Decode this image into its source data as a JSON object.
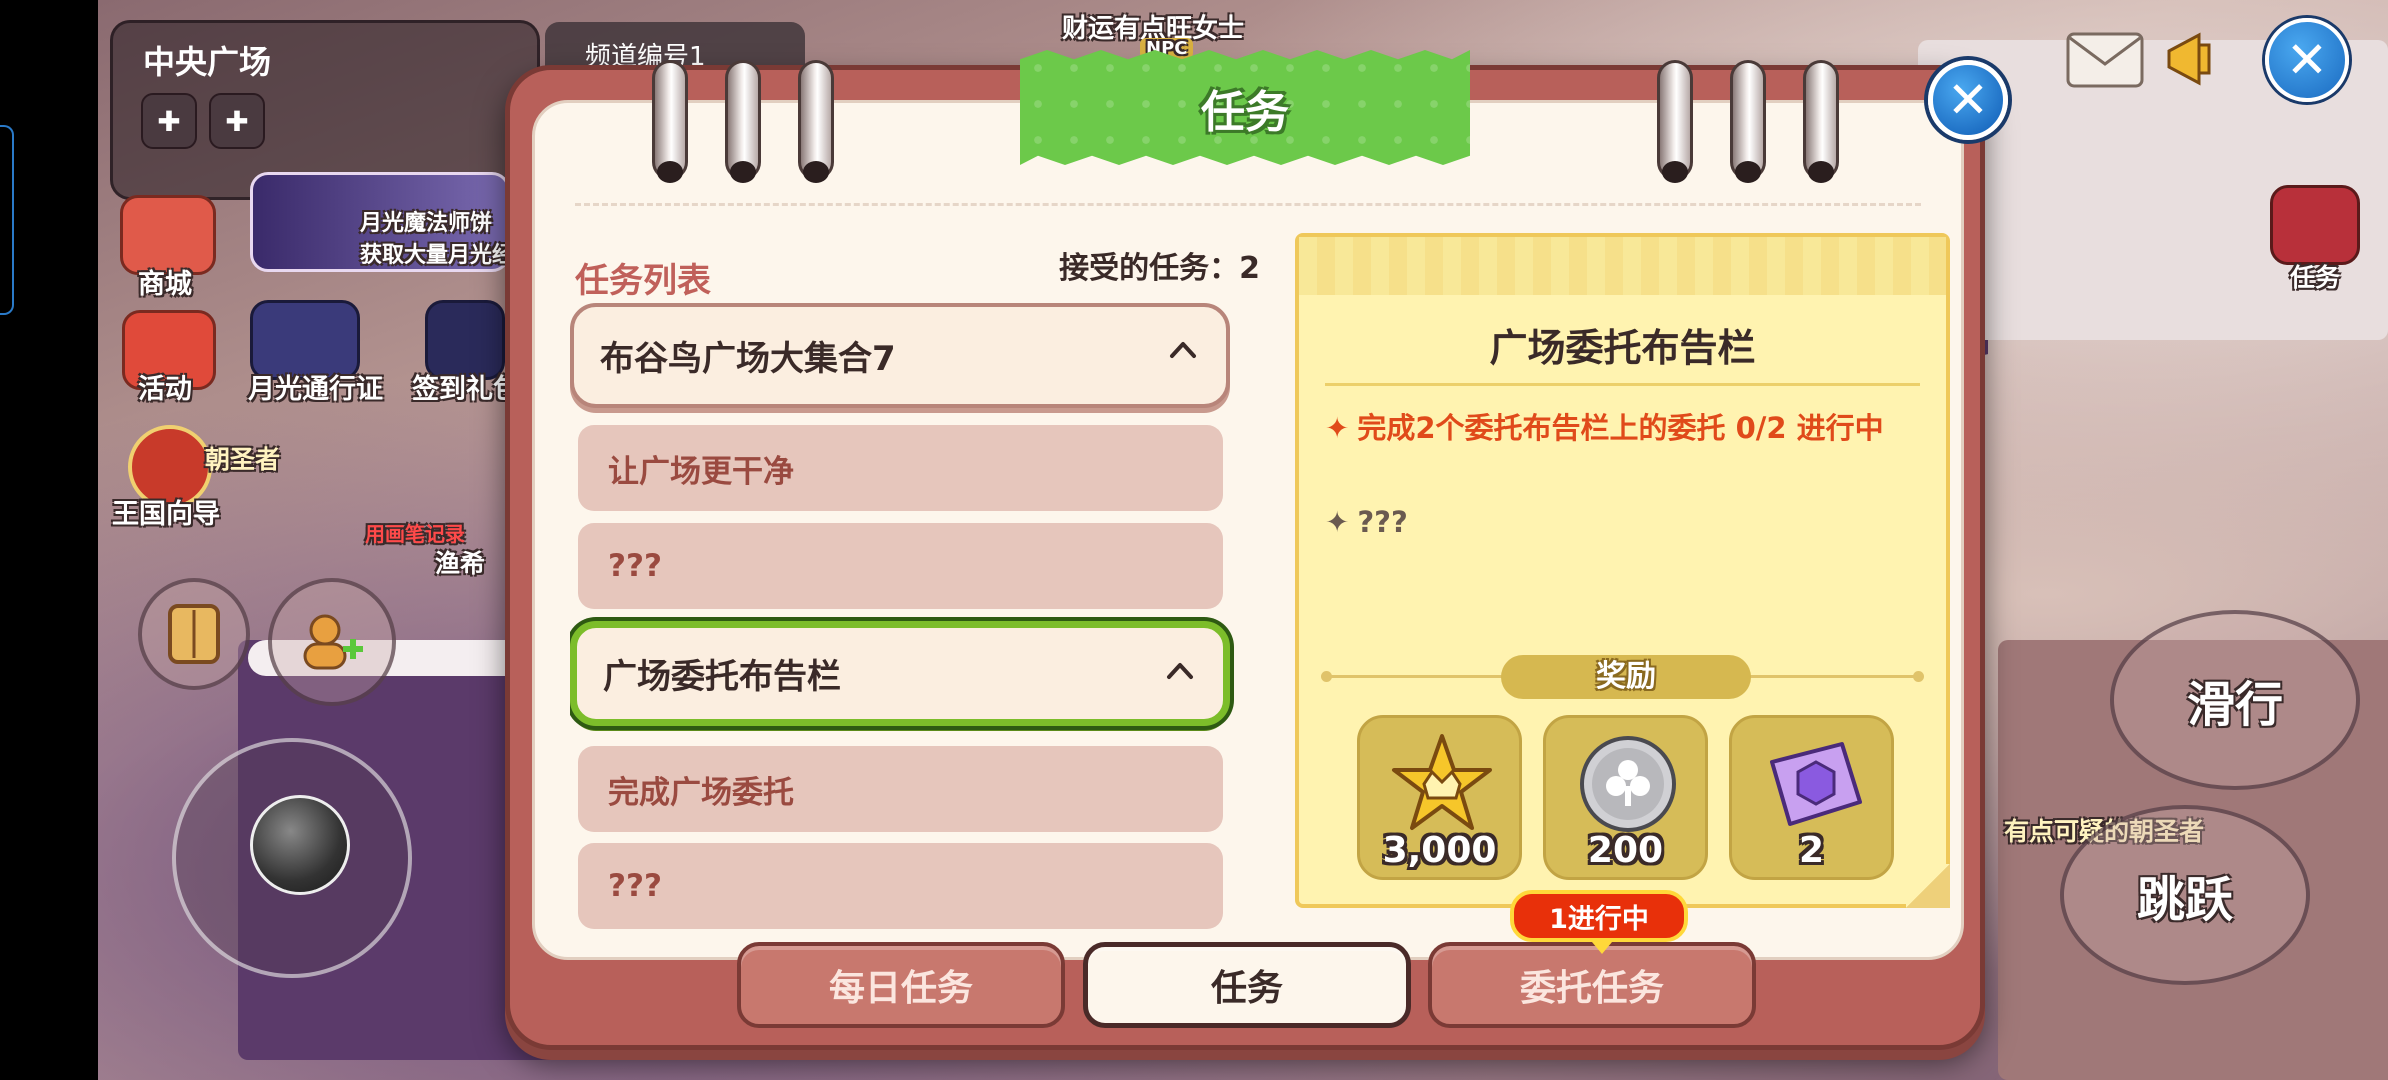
{
  "hud": {
    "location_title": "中央广场",
    "channel_label": "频道编号1",
    "npc_top_name": "财运有点旺女士",
    "npc_tag": "NPC",
    "left_menu": [
      {
        "label": "商城",
        "icon": "shop-icon"
      },
      {
        "label": "活动",
        "icon": "gift-icon"
      },
      {
        "label": "月光通行证",
        "icon": "moon-pass-icon"
      },
      {
        "label": "签到礼包",
        "icon": "checkin-icon"
      },
      {
        "label": "王国向导",
        "icon": "compass-icon"
      }
    ],
    "event_banner_line1": "月光魔法师饼",
    "event_banner_line2": "获取大量月光经",
    "pilgrim_label": "朝圣者",
    "fisherman_label": "渔希",
    "guestbook_label": "用画笔记录",
    "right_npc_name": "有点可疑的朝圣者",
    "quest_hud_label": "任务",
    "action_slide": "滑行",
    "action_jump": "跳跃"
  },
  "dialog": {
    "title": "任务",
    "list_title": "任务列表",
    "accepted_label": "接受的任务：",
    "accepted_count": "2",
    "quest_groups": [
      {
        "title": "布谷鸟广场大集合7",
        "expanded": true,
        "selected": false,
        "subtasks": [
          "让广场更干净",
          "???"
        ]
      },
      {
        "title": "广场委托布告栏",
        "expanded": true,
        "selected": true,
        "subtasks": [
          "完成广场委托",
          "???"
        ]
      }
    ],
    "detail": {
      "title": "广场委托布告栏",
      "objectives": [
        {
          "text": "完成2个委托布告栏上的委托 0/2 进行中",
          "status": "active"
        },
        {
          "text": "???",
          "status": "hidden"
        }
      ],
      "reward_label": "奖励",
      "rewards": [
        {
          "item": "crown-star-icon",
          "qty": "3,000"
        },
        {
          "item": "silver-clover-coin-icon",
          "qty": "200"
        },
        {
          "item": "purple-gem-book-icon",
          "qty": "2"
        }
      ]
    },
    "tabs": [
      {
        "label": "每日任务",
        "active": false
      },
      {
        "label": "任务",
        "active": true
      },
      {
        "label": "委托任务",
        "active": false
      }
    ],
    "tab_badge": "1进行中"
  },
  "colors": {
    "dialog_frame": "#b8605a",
    "paper": "#fdf6ec",
    "banner_green": "#6cc94a",
    "selected_border": "#7cbd2a",
    "objective_active": "#e04a1a",
    "detail_bg": "#fff3b0",
    "badge_red": "#e8300a"
  }
}
